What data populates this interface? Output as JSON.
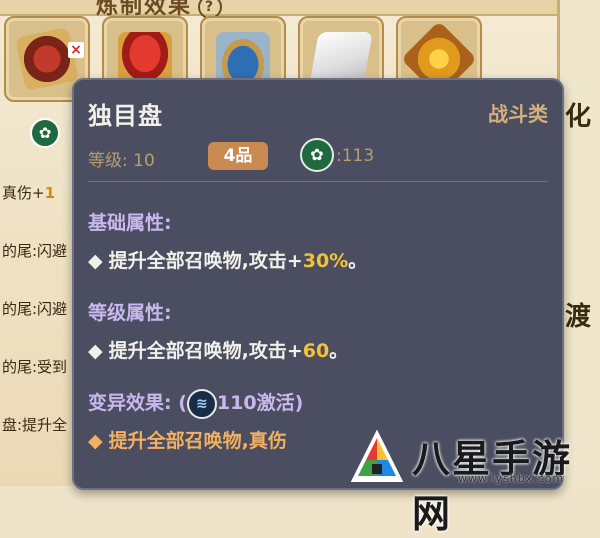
{
  "background": {
    "panel_title": "炼制效果",
    "panel_help": "?",
    "slots_count": 5,
    "left_rows": [
      {
        "text_prefix": "真伤+",
        "text_highlight": "1"
      },
      {
        "text_prefix": "的尾:闪避",
        "text_highlight": ""
      },
      {
        "text_prefix": "的尾:闪避",
        "text_highlight": ""
      },
      {
        "text_prefix": "的尾:受到",
        "text_highlight": ""
      },
      {
        "text_prefix": "盘:提升全",
        "text_highlight": ""
      }
    ],
    "right_chars": [
      "化",
      "渡"
    ],
    "remove_mark": "×"
  },
  "tooltip": {
    "name": "独目盘",
    "category": "战斗类",
    "level_label": "等级:",
    "level_value": "10",
    "grade": "4品",
    "power_value": ":113",
    "base_title": "基础属性:",
    "base_line_text": "提升全部召唤物,攻击+",
    "base_line_value": "30%",
    "base_line_end": "。",
    "level_attr_title": "等级属性:",
    "level_line_text": "提升全部召唤物,攻击+",
    "level_line_value": "60",
    "level_line_end": "。",
    "mutation_title": "变异效果:",
    "mutation_paren_open": "(",
    "mutation_req": "110激活",
    "mutation_paren_close": ")",
    "mutation_line_text": "提升全部召唤物,真伤",
    "diamond": "◆"
  },
  "watermark": {
    "brand": "八星手游网",
    "url": "www.lyshbx.com"
  },
  "colors": {
    "tooltip_bg": "#4b4d60",
    "section_title": "#c9b8ee",
    "highlight_number": "#f4c23a",
    "category": "#d4b07a",
    "grade_badge": "#c98a52",
    "mutation_text": "#f2b060"
  },
  "icons": {
    "tree_badge": "tree-icon",
    "wave_badge": "water-wave-icon"
  }
}
